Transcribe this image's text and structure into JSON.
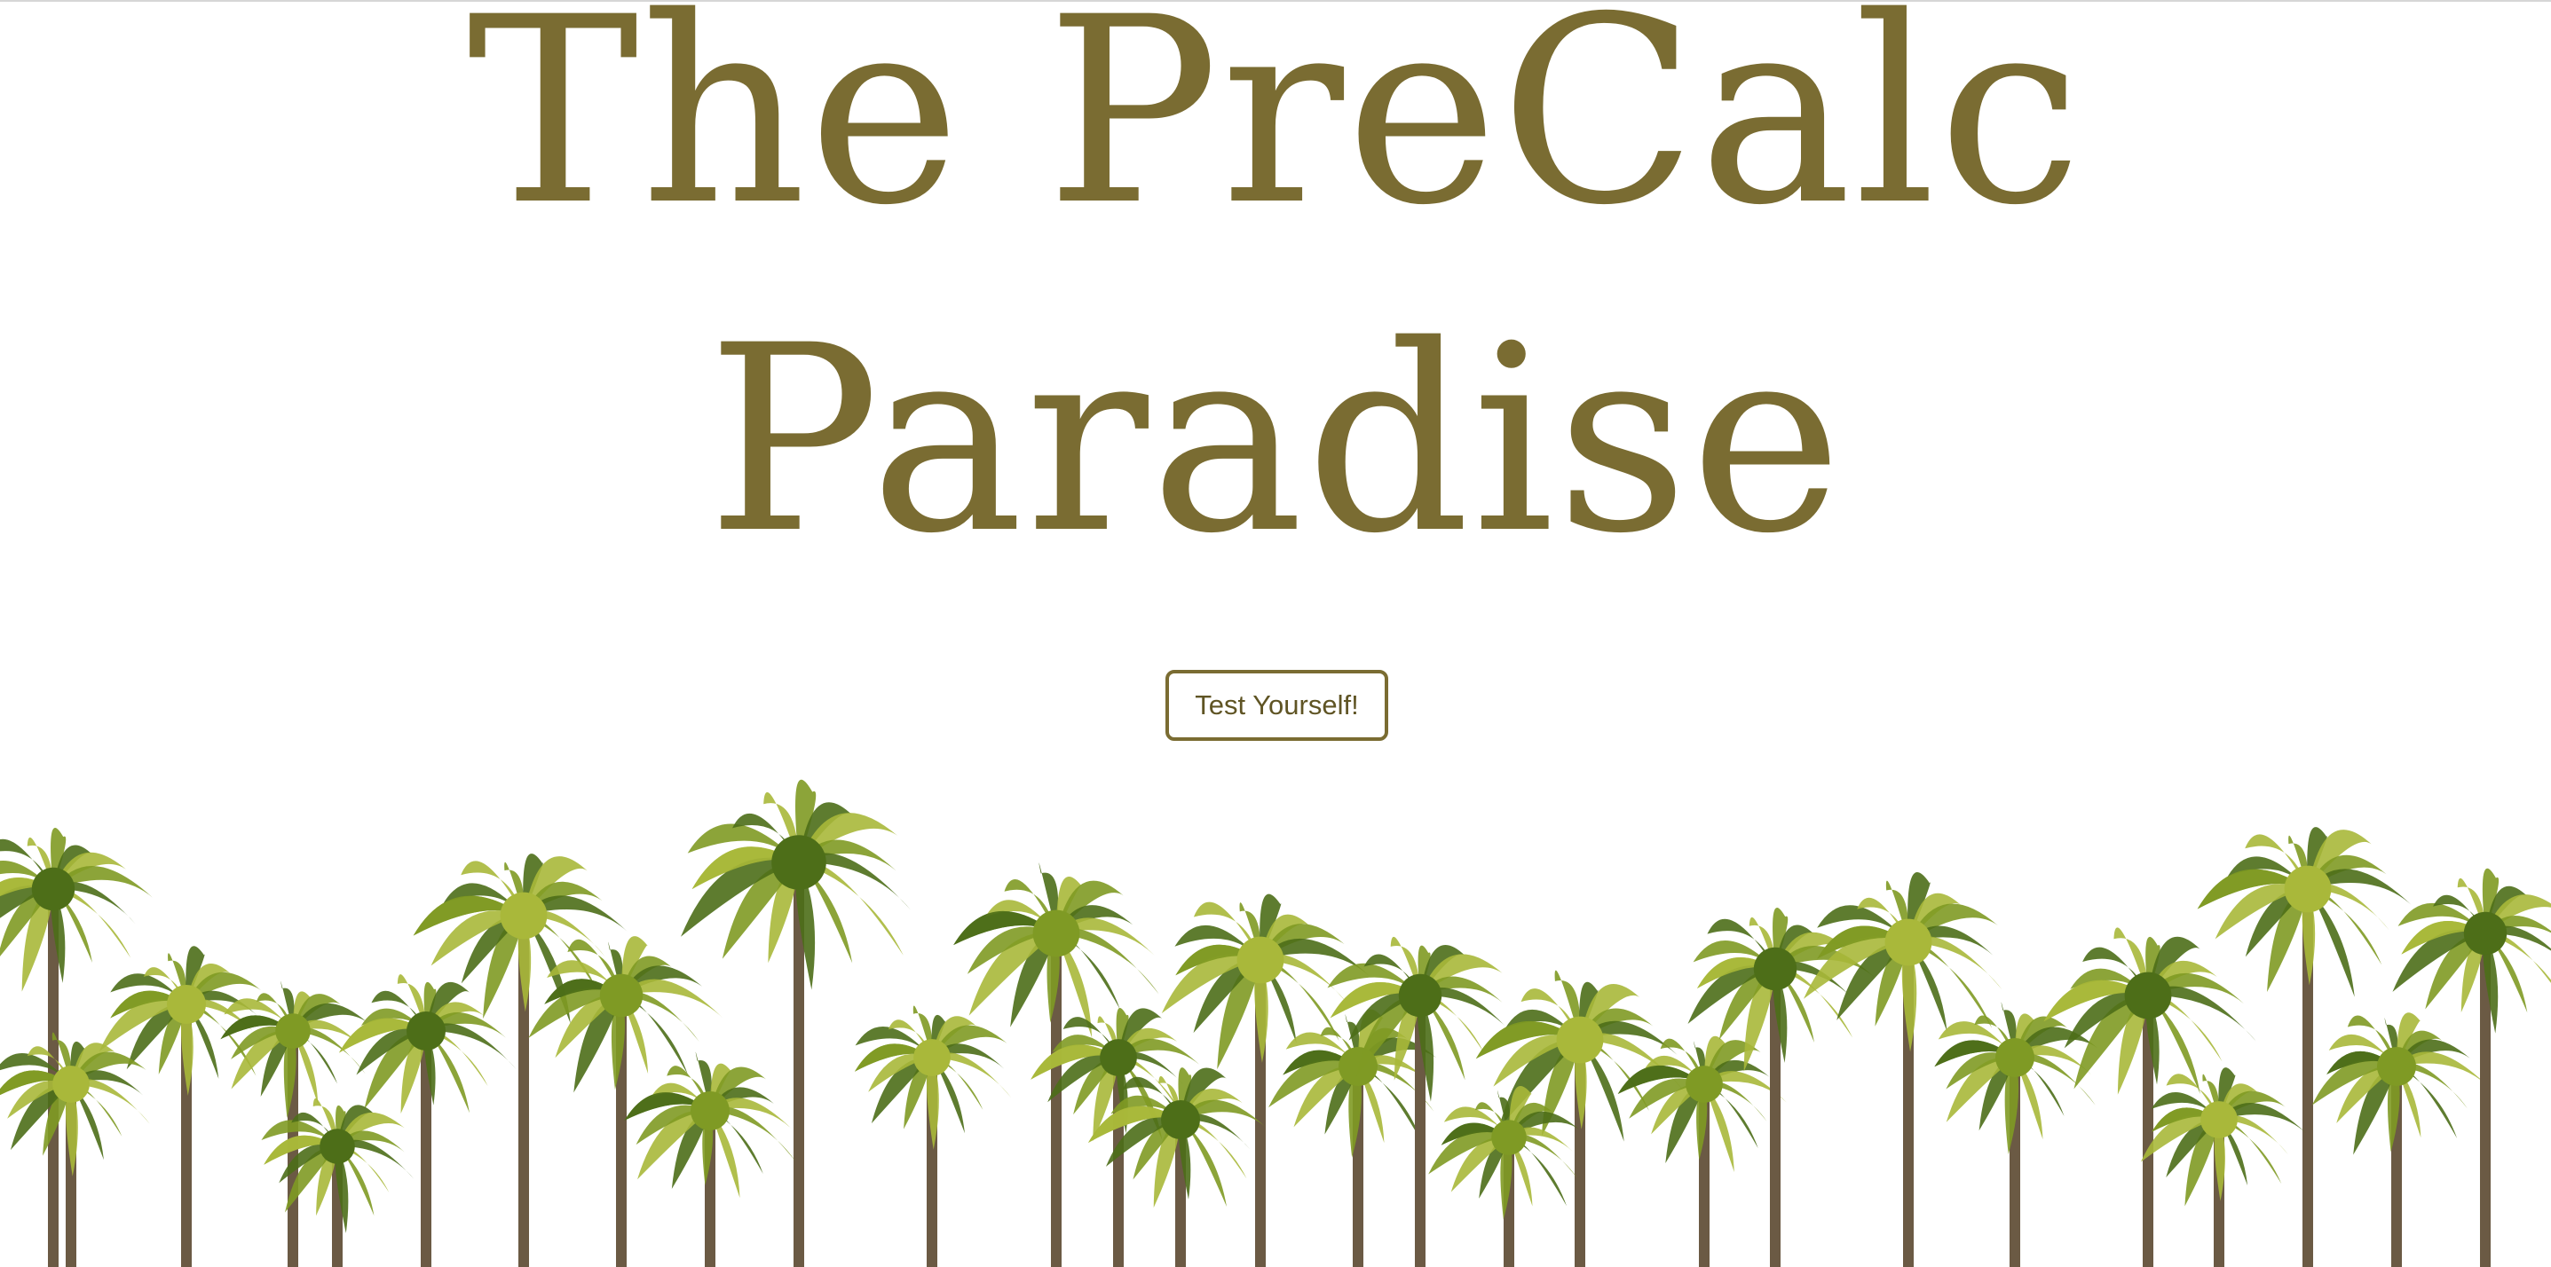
{
  "hero": {
    "title_line_1": "The PreCalc",
    "title_line_2": "Paradise",
    "button_label": "Test Yourself!"
  },
  "colors": {
    "title": "#7a6c32",
    "button_border": "#7a6c32",
    "button_text": "#5f5424",
    "background": "#ffffff",
    "palm_light": "#a9b83a",
    "palm_mid": "#7f9a24",
    "palm_dark": "#4d6e18",
    "trunk": "#6b5a44"
  },
  "images": {
    "palm_band": "palm-trees-icon"
  }
}
